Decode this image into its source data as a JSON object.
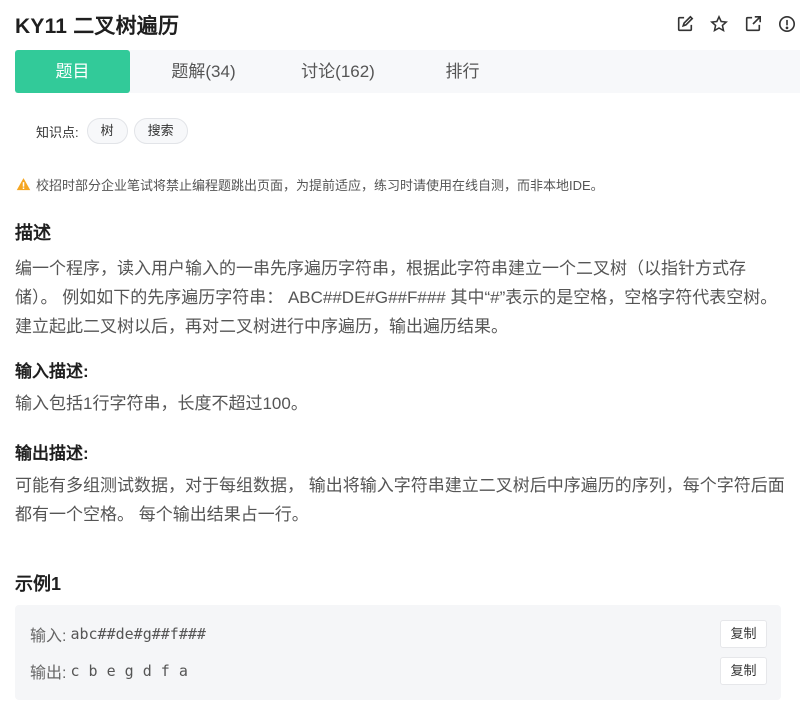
{
  "header": {
    "title": "KY11  二叉树遍历"
  },
  "tools": [
    {
      "icon": "edit-icon"
    },
    {
      "icon": "star-icon"
    },
    {
      "icon": "share-icon"
    },
    {
      "icon": "report-icon"
    }
  ],
  "tabs": [
    {
      "label": "题目"
    },
    {
      "label": "题解(34)"
    },
    {
      "label": "讨论(162)"
    },
    {
      "label": "排行"
    }
  ],
  "knowledge": {
    "label": "知识点:",
    "tags": [
      "树",
      "搜索"
    ]
  },
  "warning": "校招时部分企业笔试将禁止编程题跳出页面，为提前适应，练习时请使用在线自测，而非本地IDE。",
  "desc": {
    "heading": "描述",
    "text": "编一个程序，读入用户输入的一串先序遍历字符串，根据此字符串建立一个二叉树（以指针方式存储）。 例如如下的先序遍历字符串： ABC##DE#G##F### 其中“#”表示的是空格，空格字符代表空树。建立起此二叉树以后，再对二叉树进行中序遍历，输出遍历结果。"
  },
  "input": {
    "heading": "输入描述:",
    "text": "输入包括1行字符串，长度不超过100。"
  },
  "output": {
    "heading": "输出描述:",
    "text": "可能有多组测试数据，对于每组数据， 输出将输入字符串建立二叉树后中序遍历的序列，每个字符后面都有一个空格。 每个输出结果占一行。"
  },
  "example": {
    "heading": "示例1",
    "input_label": "输入:",
    "input_value": "abc##de#g##f###",
    "output_label": "输出:",
    "output_value": "c b e g d f a",
    "copy_label": "复制"
  },
  "colors": {
    "accent": "#32ca99",
    "warning": "#f5a623"
  }
}
